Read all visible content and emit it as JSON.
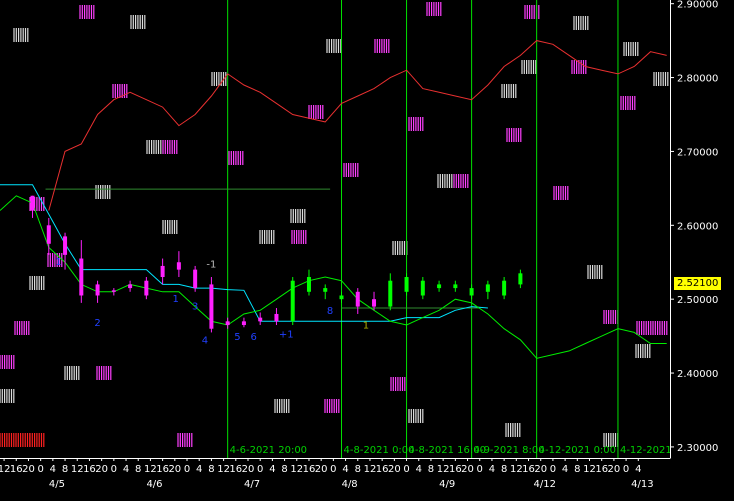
{
  "chart_data": {
    "type": "line",
    "title": "",
    "y_axis": {
      "ticks": [
        "2.90000",
        "2.80000",
        "2.70000",
        "2.60000",
        "2.50000",
        "2.40000",
        "2.30000"
      ],
      "tick_values": [
        2.9,
        2.8,
        2.7,
        2.6,
        2.5,
        2.4,
        2.3
      ],
      "range": [
        2.285,
        2.905
      ]
    },
    "last_price_label": "2.52100",
    "last_price": 2.521,
    "x_axis": {
      "hour_labels": [
        "12",
        "16",
        "20",
        "0",
        "4",
        "8",
        "12",
        "16",
        "20",
        "0",
        "4",
        "8",
        "12",
        "16",
        "20",
        "0",
        "4",
        "8",
        "12",
        "16",
        "20",
        "0",
        "4",
        "8",
        "12",
        "16",
        "20",
        "0",
        "4",
        "8",
        "12",
        "16",
        "20",
        "0",
        "4",
        "8",
        "12",
        "16",
        "20",
        "0",
        "4",
        "8",
        "12",
        "16",
        "20",
        "0",
        "4",
        "8",
        "12",
        "16",
        "20",
        "0",
        "4"
      ],
      "date_labels": [
        "4/5",
        "4/6",
        "4/7",
        "4/8",
        "4/9",
        "4/12",
        "4/13"
      ],
      "date_label_index": [
        2.5,
        8.5,
        14.5,
        20.5,
        26.5,
        32.5,
        38.5
      ],
      "index_range": [
        -1.0,
        40.2
      ]
    },
    "vertical_lines": [
      {
        "index": 13.0,
        "label": "4-6-2021 20:00"
      },
      {
        "index": 20.0,
        "label": "4-8-2021 0:00"
      },
      {
        "index": 24.0,
        "label": "4-8-2021 16:00"
      },
      {
        "index": 28.0,
        "label": "4-9-2021 8:00"
      },
      {
        "index": 32.0,
        "label": "4-12-2021 0:00"
      },
      {
        "index": 37.0,
        "label": "4-12-2021"
      }
    ],
    "horizontal_segments": [
      {
        "from": 1.8,
        "to": 19.3,
        "y": 2.649,
        "color": "#2f8a2f"
      },
      {
        "from": 20.0,
        "to": 28.5,
        "y": 2.488,
        "color": "#2f8a2f"
      }
    ],
    "series": [
      {
        "color": "#e83030",
        "x": [
          2,
          3,
          4,
          5,
          6,
          7,
          8,
          9,
          10,
          11,
          12,
          13,
          14,
          15,
          16,
          17,
          18,
          19,
          20,
          21,
          22,
          23,
          24,
          25,
          26,
          27,
          28,
          29,
          30,
          31,
          32,
          33,
          34,
          35,
          36,
          37,
          38,
          39,
          40
        ],
        "values": [
          2.62,
          2.7,
          2.71,
          2.75,
          2.77,
          2.78,
          2.77,
          2.76,
          2.735,
          2.75,
          2.775,
          2.805,
          2.79,
          2.78,
          2.765,
          2.75,
          2.745,
          2.74,
          2.765,
          2.775,
          2.785,
          2.8,
          2.81,
          2.785,
          2.78,
          2.775,
          2.77,
          2.79,
          2.815,
          2.83,
          2.85,
          2.845,
          2.83,
          2.815,
          2.81,
          2.805,
          2.815,
          2.835,
          2.83
        ]
      },
      {
        "color": "#00e5ff",
        "x": [
          -1,
          1,
          2,
          3,
          4,
          5,
          6,
          7,
          8,
          9,
          10,
          11,
          12,
          13,
          14,
          15,
          16,
          17,
          18,
          19,
          20,
          21,
          22,
          23,
          24,
          25,
          26,
          27,
          28,
          29
        ],
        "values": [
          2.655,
          2.655,
          2.615,
          2.575,
          2.54,
          2.54,
          2.54,
          2.54,
          2.54,
          2.52,
          2.52,
          2.515,
          2.515,
          2.513,
          2.512,
          2.47,
          2.47,
          2.47,
          2.47,
          2.47,
          2.47,
          2.47,
          2.47,
          2.47,
          2.475,
          2.475,
          2.475,
          2.485,
          2.49,
          2.488
        ]
      },
      {
        "color": "#00ee00",
        "x": [
          -1,
          0,
          1,
          2,
          3,
          4,
          5,
          6,
          7,
          8,
          9,
          10,
          11,
          12,
          13,
          14,
          15,
          16,
          17,
          18,
          19,
          20,
          21,
          22,
          23,
          24,
          25,
          26,
          27,
          28,
          29,
          30,
          31,
          32,
          33,
          34,
          35,
          36,
          37,
          38,
          39,
          40
        ],
        "values": [
          2.62,
          2.64,
          2.63,
          2.57,
          2.55,
          2.52,
          2.51,
          2.51,
          2.52,
          2.515,
          2.51,
          2.51,
          2.49,
          2.47,
          2.465,
          2.48,
          2.485,
          2.5,
          2.515,
          2.525,
          2.53,
          2.525,
          2.5,
          2.485,
          2.47,
          2.465,
          2.475,
          2.485,
          2.5,
          2.495,
          2.48,
          2.46,
          2.445,
          2.42,
          2.425,
          2.43,
          2.44,
          2.45,
          2.46,
          2.455,
          2.44,
          2.44
        ]
      }
    ],
    "candles": [
      {
        "x": 1.0,
        "o": 2.62,
        "h": 2.64,
        "l": 2.61,
        "c": 2.64,
        "color": "#ff20ff"
      },
      {
        "x": 2.0,
        "o": 2.6,
        "h": 2.61,
        "l": 2.56,
        "c": 2.575,
        "color": "#ff20ff"
      },
      {
        "x": 3.0,
        "o": 2.585,
        "h": 2.59,
        "l": 2.54,
        "c": 2.56,
        "color": "#ff20ff"
      },
      {
        "x": 4.0,
        "o": 2.555,
        "h": 2.58,
        "l": 2.495,
        "c": 2.505,
        "color": "#ff20ff"
      },
      {
        "x": 5.0,
        "o": 2.52,
        "h": 2.525,
        "l": 2.495,
        "c": 2.505,
        "color": "#ff20ff"
      },
      {
        "x": 6.0,
        "o": 2.512,
        "h": 2.515,
        "l": 2.505,
        "c": 2.51,
        "color": "#ff20ff"
      },
      {
        "x": 7.0,
        "o": 2.52,
        "h": 2.525,
        "l": 2.51,
        "c": 2.515,
        "color": "#ff20ff"
      },
      {
        "x": 8.0,
        "o": 2.525,
        "h": 2.53,
        "l": 2.5,
        "c": 2.505,
        "color": "#ff20ff"
      },
      {
        "x": 9.0,
        "o": 2.545,
        "h": 2.555,
        "l": 2.52,
        "c": 2.53,
        "color": "#ff20ff"
      },
      {
        "x": 10.0,
        "o": 2.55,
        "h": 2.565,
        "l": 2.53,
        "c": 2.54,
        "color": "#ff20ff"
      },
      {
        "x": 11.0,
        "o": 2.54,
        "h": 2.545,
        "l": 2.51,
        "c": 2.515,
        "color": "#ff20ff"
      },
      {
        "x": 12.0,
        "o": 2.52,
        "h": 2.53,
        "l": 2.455,
        "c": 2.46,
        "color": "#ff20ff"
      },
      {
        "x": 13.0,
        "o": 2.47,
        "h": 2.475,
        "l": 2.46,
        "c": 2.465,
        "color": "#ff20ff"
      },
      {
        "x": 14.0,
        "o": 2.47,
        "h": 2.475,
        "l": 2.462,
        "c": 2.465,
        "color": "#ff20ff"
      },
      {
        "x": 15.0,
        "o": 2.475,
        "h": 2.482,
        "l": 2.465,
        "c": 2.47,
        "color": "#ff20ff"
      },
      {
        "x": 16.0,
        "o": 2.48,
        "h": 2.488,
        "l": 2.465,
        "c": 2.47,
        "color": "#ff20ff"
      },
      {
        "x": 17.0,
        "o": 2.47,
        "h": 2.53,
        "l": 2.465,
        "c": 2.525,
        "color": "#00ff00"
      },
      {
        "x": 18.0,
        "o": 2.51,
        "h": 2.54,
        "l": 2.505,
        "c": 2.53,
        "color": "#00ff00"
      },
      {
        "x": 19.0,
        "o": 2.51,
        "h": 2.52,
        "l": 2.5,
        "c": 2.515,
        "color": "#00ff00"
      },
      {
        "x": 20.0,
        "o": 2.505,
        "h": 2.51,
        "l": 2.495,
        "c": 2.5,
        "color": "#00ff00"
      },
      {
        "x": 21.0,
        "o": 2.51,
        "h": 2.515,
        "l": 2.48,
        "c": 2.49,
        "color": "#ff20ff"
      },
      {
        "x": 22.0,
        "o": 2.5,
        "h": 2.51,
        "l": 2.485,
        "c": 2.49,
        "color": "#ff20ff"
      },
      {
        "x": 23.0,
        "o": 2.49,
        "h": 2.535,
        "l": 2.485,
        "c": 2.525,
        "color": "#00ff00"
      },
      {
        "x": 24.0,
        "o": 2.51,
        "h": 2.535,
        "l": 2.505,
        "c": 2.53,
        "color": "#00ff00"
      },
      {
        "x": 25.0,
        "o": 2.505,
        "h": 2.53,
        "l": 2.5,
        "c": 2.525,
        "color": "#00ff00"
      },
      {
        "x": 26.0,
        "o": 2.515,
        "h": 2.525,
        "l": 2.51,
        "c": 2.52,
        "color": "#00ff00"
      },
      {
        "x": 27.0,
        "o": 2.515,
        "h": 2.525,
        "l": 2.51,
        "c": 2.52,
        "color": "#00ff00"
      },
      {
        "x": 28.0,
        "o": 2.505,
        "h": 2.52,
        "l": 2.5,
        "c": 2.515,
        "color": "#00ff00"
      },
      {
        "x": 29.0,
        "o": 2.51,
        "h": 2.525,
        "l": 2.5,
        "c": 2.52,
        "color": "#00ff00"
      },
      {
        "x": 30.0,
        "o": 2.505,
        "h": 2.53,
        "l": 2.5,
        "c": 2.525,
        "color": "#00ff00"
      },
      {
        "x": 31.0,
        "o": 2.52,
        "h": 2.54,
        "l": 2.515,
        "c": 2.535,
        "color": "#00ff00"
      }
    ],
    "wave_labels": [
      {
        "text": "1",
        "x": 2.6,
        "y": 2.546,
        "color": "#2040ff"
      },
      {
        "text": "2",
        "x": 5.0,
        "y": 2.464,
        "color": "#2040ff"
      },
      {
        "text": "1",
        "x": 9.8,
        "y": 2.496,
        "color": "#2040ff"
      },
      {
        "text": "3",
        "x": 11.0,
        "y": 2.486,
        "color": "#2040ff"
      },
      {
        "text": "-1",
        "x": 12.0,
        "y": 2.543,
        "color": "#bbbbbb"
      },
      {
        "text": "4",
        "x": 11.6,
        "y": 2.44,
        "color": "#2040ff"
      },
      {
        "text": "5",
        "x": 13.6,
        "y": 2.445,
        "color": "#2040ff"
      },
      {
        "text": "6",
        "x": 14.6,
        "y": 2.445,
        "color": "#2040ff"
      },
      {
        "text": "+1",
        "x": 16.6,
        "y": 2.448,
        "color": "#2040ff"
      },
      {
        "text": "8",
        "x": 19.3,
        "y": 2.48,
        "color": "#2040ff"
      },
      {
        "text": "1",
        "x": 21.5,
        "y": 2.46,
        "color": "#b0b000"
      }
    ]
  }
}
